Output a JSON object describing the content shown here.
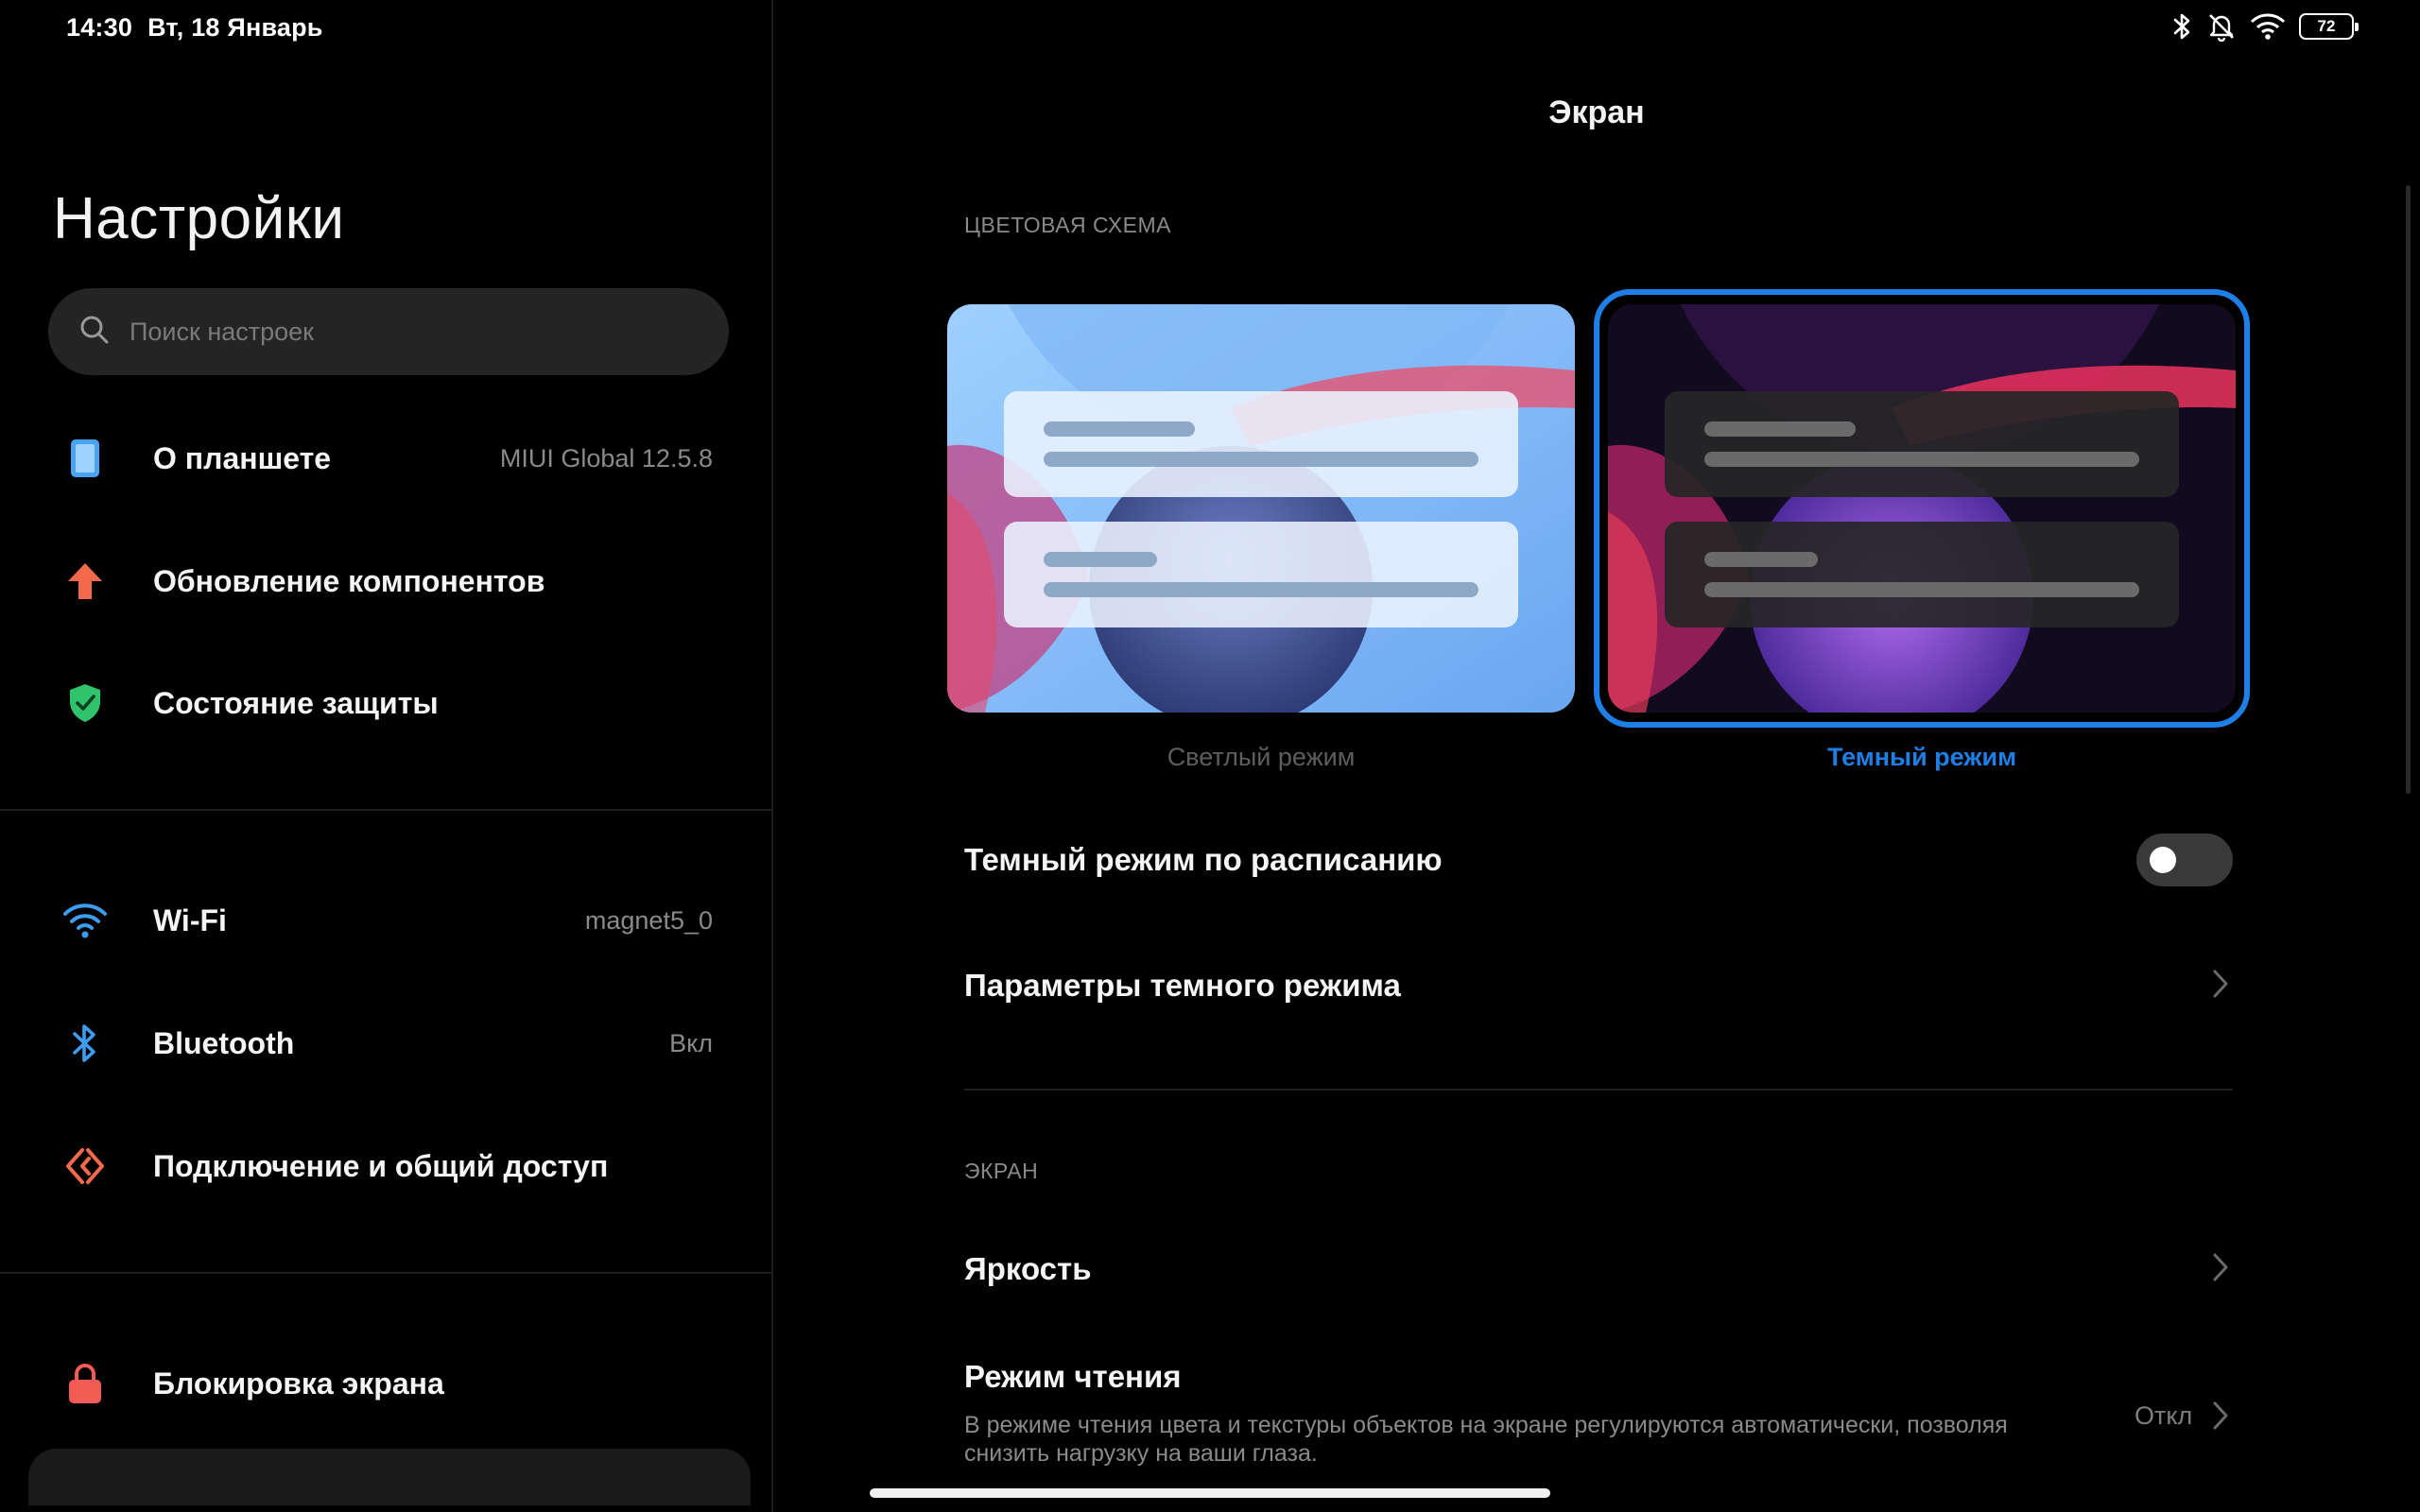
{
  "status_bar": {
    "time": "14:30",
    "date": "Вт, 18 Январь",
    "battery": "72",
    "icons": [
      "bluetooth-icon",
      "mute-bell-icon",
      "wifi-icon",
      "battery-icon"
    ]
  },
  "sidebar": {
    "title": "Настройки",
    "search_placeholder": "Поиск настроек",
    "items": [
      {
        "label": "О планшете",
        "value": "MIUI Global 12.5.8",
        "icon": "tablet-icon",
        "color": "#4aa3f0"
      },
      {
        "label": "Обновление компонентов",
        "value": "",
        "icon": "update-arrow-icon",
        "color": "#f26a4b"
      },
      {
        "label": "Состояние защиты",
        "value": "",
        "icon": "shield-check-icon",
        "color": "#2fc46b"
      },
      {
        "label": "Wi-Fi",
        "value": "magnet5_0",
        "icon": "wifi-icon",
        "color": "#3d9df0"
      },
      {
        "label": "Bluetooth",
        "value": "Вкл",
        "icon": "bluetooth-icon",
        "color": "#3d9df0"
      },
      {
        "label": "Подключение и общий доступ",
        "value": "",
        "icon": "connection-share-icon",
        "color": "#f26a4b"
      },
      {
        "label": "Блокировка экрана",
        "value": "",
        "icon": "lock-icon",
        "color": "#f25c54"
      }
    ]
  },
  "main": {
    "title": "Экран",
    "color_scheme_header": "ЦВЕТОВАЯ СХЕМА",
    "themes": [
      {
        "label": "Светлый режим",
        "selected": false
      },
      {
        "label": "Темный режим",
        "selected": true
      }
    ],
    "dark_schedule": {
      "label": "Темный режим по расписанию",
      "enabled": false
    },
    "dark_params": {
      "label": "Параметры темного режима"
    },
    "screen_header": "ЭКРАН",
    "brightness": {
      "label": "Яркость"
    },
    "reading_mode": {
      "label": "Режим чтения",
      "description_line1": "В режиме чтения цвета и текстуры объектов на экране регулируются автоматически, позволяя",
      "description_line2": "снизить нагрузку на ваши глаза.",
      "value": "Откл"
    }
  },
  "colors": {
    "accent": "#1e7fe6",
    "background": "#000000",
    "secondary_text": "#8a8a8a"
  }
}
